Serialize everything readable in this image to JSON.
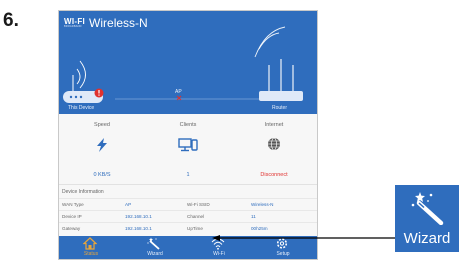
{
  "step_number": "6.",
  "app": {
    "logo_main": "WI-FI",
    "logo_sub": "BROADBAND",
    "title": "Wireless-N"
  },
  "hero": {
    "device_label": "This Device",
    "ap_label": "AP",
    "router_label": "Router",
    "alert_icon": "exclamation-badge",
    "link_status_icon": "x-mark"
  },
  "stats": [
    {
      "title": "Speed",
      "value": "0 KB/S",
      "icon": "lightning-icon",
      "value_color": "#2f6dbd"
    },
    {
      "title": "Clients",
      "value": "1",
      "icon": "devices-icon",
      "value_color": "#2f6dbd"
    },
    {
      "title": "Internet",
      "value": "Disconnect",
      "icon": "globe-icon",
      "value_color": "#e0312e"
    }
  ],
  "device_info": {
    "heading": "Device Information",
    "rows": [
      {
        "label1": "WAN Type",
        "value1": "AP",
        "label2": "Wi-Fi SSID",
        "value2": "Wireless-N"
      },
      {
        "label1": "Device IP",
        "value1": "192.168.10.1",
        "label2": "Channel",
        "value2": "11"
      },
      {
        "label1": "Gateway",
        "value1": "192.168.10.1",
        "label2": "UpTime",
        "value2": "00h25m"
      }
    ]
  },
  "tabs": [
    {
      "label": "Status",
      "icon": "home-icon",
      "active": true
    },
    {
      "label": "Wizard",
      "icon": "magic-wand-icon",
      "active": false
    },
    {
      "label": "Wi-Fi",
      "icon": "wifi-icon",
      "active": false
    },
    {
      "label": "Setup",
      "icon": "gear-icon",
      "active": false
    }
  ],
  "callout": {
    "label": "Wizard",
    "icon": "magic-wand-icon"
  },
  "colors": {
    "brand_blue": "#2f6dbd",
    "active_tab": "#e8a53a",
    "alert_red": "#e0312e"
  }
}
